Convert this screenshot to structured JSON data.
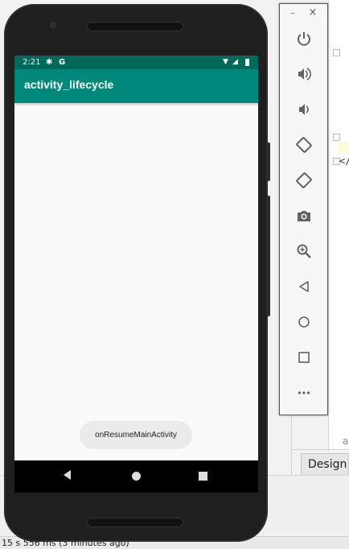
{
  "app": {
    "title": "activity_lifecycle",
    "status_time": "2:21",
    "status_g": "G"
  },
  "toast": {
    "text": "onResumeMainActivity"
  },
  "ide": {
    "design_tab": "Design",
    "status_text": "15 s 556 ms (3 minutes ago)",
    "code_fragment": "</",
    "right_fragment": "a"
  },
  "emulator_tools": {
    "minimize": "–",
    "close": "×",
    "items": [
      "power",
      "volume-up",
      "volume-down",
      "rotate-left",
      "rotate-right",
      "screenshot",
      "zoom",
      "back",
      "home",
      "overview",
      "more"
    ]
  },
  "colors": {
    "status_bar": "#00695c",
    "app_bar": "#00897b",
    "screen_bg": "#fafafa",
    "icon": "#5f6368"
  }
}
